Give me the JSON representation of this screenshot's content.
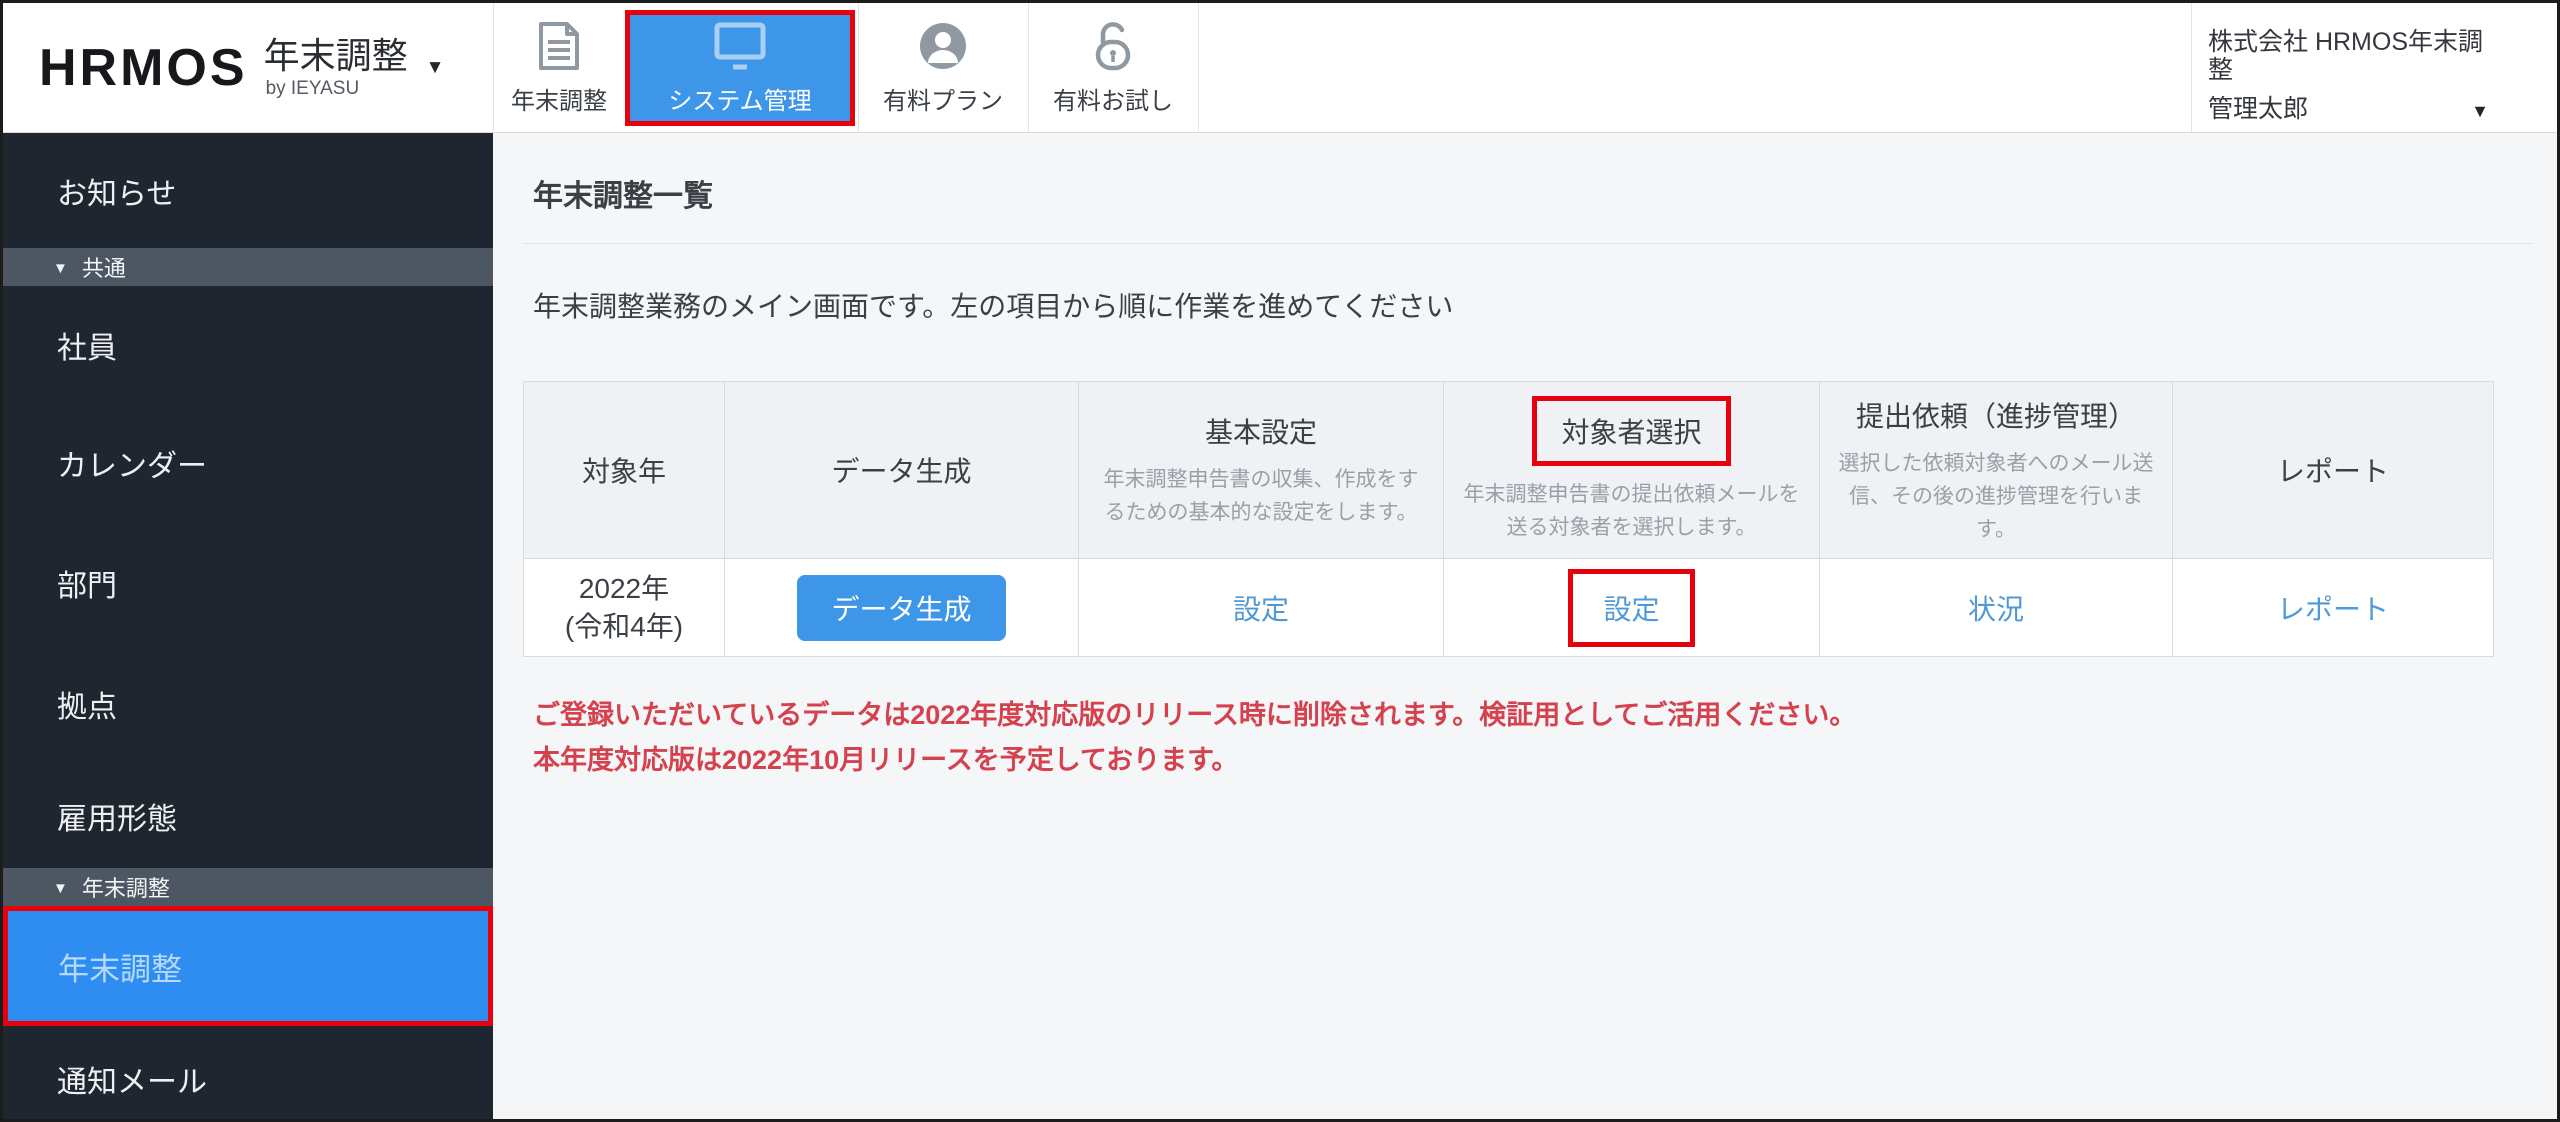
{
  "header": {
    "logo": {
      "brand": "HRMOS",
      "product": "年末調整",
      "byline": "by IEYASU",
      "caret": "▼"
    },
    "nav": [
      {
        "label": "年末調整"
      },
      {
        "label": "システム管理"
      },
      {
        "label": "有料プラン"
      },
      {
        "label": "有料お試し"
      }
    ],
    "account": {
      "company": "株式会社 HRMOS年末調整",
      "user": "管理太郎",
      "caret": "▼"
    }
  },
  "sidebar": {
    "caret": "▼",
    "item_news": "お知らせ",
    "section_common": "共通",
    "item_employee": "社員",
    "item_calendar": "カレンダー",
    "item_department": "部門",
    "item_location": "拠点",
    "item_employment": "雇用形態",
    "section_nencho": "年末調整",
    "item_nencho": "年末調整",
    "item_mail": "通知メール"
  },
  "main": {
    "title": "年末調整一覧",
    "description": "年末調整業務のメイン画面です。左の項目から順に作業を進めてください",
    "table": {
      "columns": [
        {
          "label": "対象年",
          "subtitle": ""
        },
        {
          "label": "データ生成",
          "subtitle": ""
        },
        {
          "label": "基本設定",
          "subtitle": "年末調整申告書の収集、作成をするための基本的な設定をします。"
        },
        {
          "label": "対象者選択",
          "subtitle": "年末調整申告書の提出依頼メールを送る対象者を選択します。"
        },
        {
          "label": "提出依頼（進捗管理）",
          "subtitle": "選択した依頼対象者へのメール送信、その後の進捗管理を行います。"
        },
        {
          "label": "レポート",
          "subtitle": ""
        }
      ],
      "row": {
        "year_line1": "2022年",
        "year_line2": "(令和4年)",
        "generate_button": "データ生成",
        "basic_settings_link": "設定",
        "target_select_link": "設定",
        "progress_link": "状況",
        "report_link": "レポート"
      }
    },
    "warning_line1": "ご登録いただいているデータは2022年度対応版のリリース時に削除されます。検証用としてご活用ください。",
    "warning_line2": "本年度対応版は2022年10月リリースを予定しております。"
  },
  "colors": {
    "accent_blue": "#3e96e8",
    "sidebar_selected_blue": "#2f8df2",
    "link_blue": "#4f9ad6",
    "annotation_red": "#e8000d",
    "warning_red": "#d5424e",
    "sidebar_bg": "#20262f",
    "sidebar_section_bg": "#4d5763"
  }
}
